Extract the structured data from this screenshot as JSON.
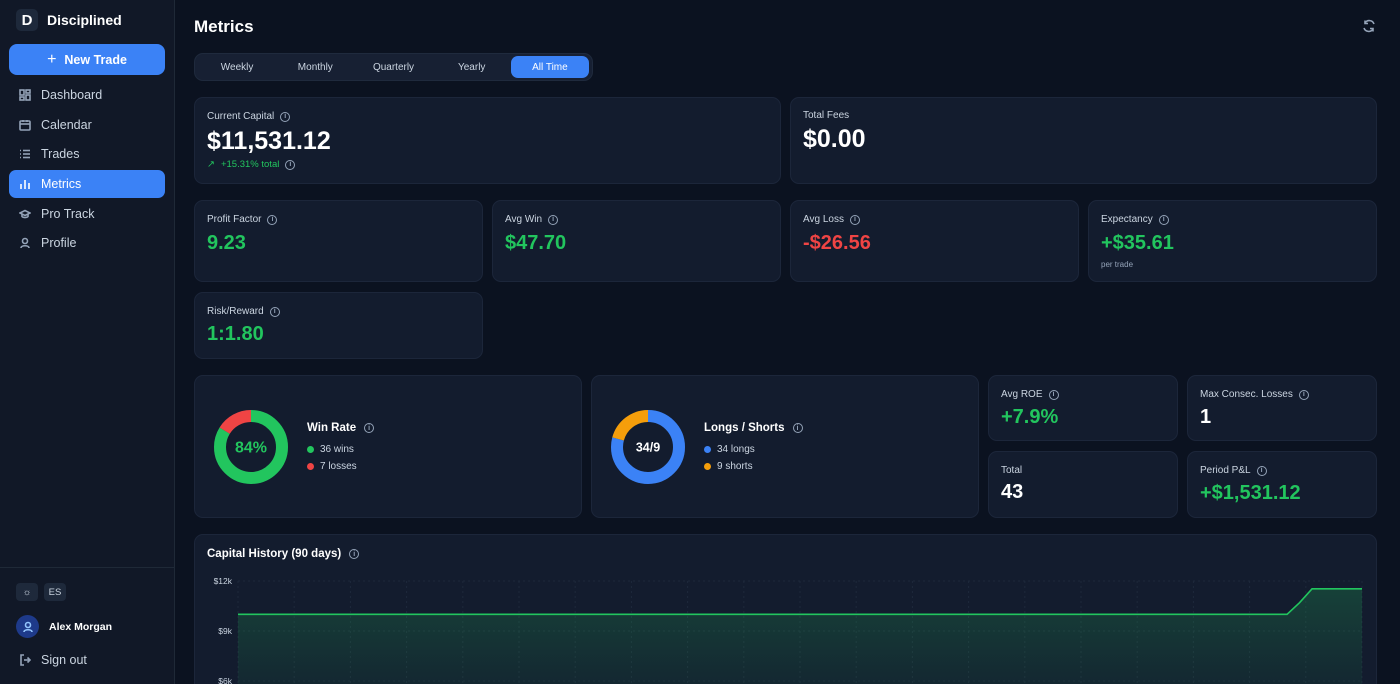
{
  "app": {
    "logo_letter": "D",
    "name": "Disciplined"
  },
  "sidebar": {
    "new_trade": "New Trade",
    "items": [
      {
        "label": "Dashboard",
        "icon": "dashboard-icon"
      },
      {
        "label": "Calendar",
        "icon": "calendar-icon"
      },
      {
        "label": "Trades",
        "icon": "list-icon"
      },
      {
        "label": "Metrics",
        "icon": "bar-chart-icon",
        "active": true
      },
      {
        "label": "Pro Track",
        "icon": "graduation-cap-icon"
      },
      {
        "label": "Profile",
        "icon": "user-icon"
      }
    ],
    "theme_icon": "sun-icon",
    "language": "ES",
    "user_name": "Alex Morgan",
    "sign_out": "Sign out"
  },
  "header": {
    "title": "Metrics"
  },
  "periods": {
    "options": [
      "Weekly",
      "Monthly",
      "Quarterly",
      "Yearly",
      "All Time"
    ],
    "selected": "All Time"
  },
  "metrics": {
    "current_capital": {
      "label": "Current Capital",
      "value": "$11,531.12",
      "change": "+15.31% total"
    },
    "total_fees": {
      "label": "Total Fees",
      "value": "$0.00"
    },
    "profit_factor": {
      "label": "Profit Factor",
      "value": "9.23"
    },
    "avg_win": {
      "label": "Avg Win",
      "value": "$47.70"
    },
    "avg_loss": {
      "label": "Avg Loss",
      "value": "-$26.56"
    },
    "expectancy": {
      "label": "Expectancy",
      "value": "+$35.61",
      "sub": "per trade"
    },
    "risk_reward": {
      "label": "Risk/Reward",
      "value": "1:1.80"
    },
    "avg_roe": {
      "label": "Avg ROE",
      "value": "+7.9%"
    },
    "max_consec_losses": {
      "label": "Max Consec. Losses",
      "value": "1"
    },
    "total": {
      "label": "Total",
      "value": "43"
    },
    "period_pnl": {
      "label": "Period P&L",
      "value": "+$1,531.12"
    }
  },
  "win_rate": {
    "title": "Win Rate",
    "center": "84%",
    "wins": 36,
    "losses": 7,
    "wins_label": "36 wins",
    "losses_label": "7 losses"
  },
  "longs_shorts": {
    "title": "Longs / Shorts",
    "center": "34/9",
    "longs": 34,
    "shorts": 9,
    "longs_label": "34 longs",
    "shorts_label": "9 shorts"
  },
  "colors": {
    "accent": "#3b82f6",
    "green": "#22c55e",
    "red": "#ef4444",
    "orange": "#f59e0b"
  },
  "chart_data": {
    "type": "area",
    "title": "Capital History (90 days)",
    "y_ticks": [
      "$12k",
      "$9k",
      "$6k"
    ],
    "ylim": [
      6000,
      12000
    ],
    "x": [
      0,
      84,
      85,
      86,
      90
    ],
    "values": [
      10000,
      10000,
      10700,
      11531,
      11531
    ],
    "grid": true
  }
}
